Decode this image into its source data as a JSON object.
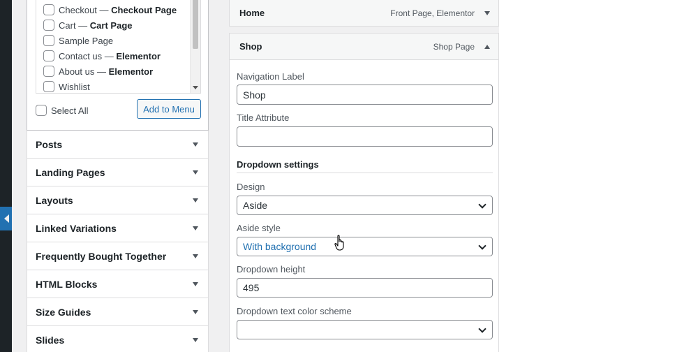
{
  "left_panel": {
    "pages": [
      {
        "label": "Checkout",
        "tag": "Checkout Page"
      },
      {
        "label": "Cart",
        "tag": "Cart Page"
      },
      {
        "label": "Sample Page",
        "tag": ""
      },
      {
        "label": "Contact us",
        "tag": "Elementor"
      },
      {
        "label": "About us",
        "tag": "Elementor"
      },
      {
        "label": "Wishlist",
        "tag": ""
      }
    ],
    "separator": " — ",
    "select_all_label": "Select All",
    "add_to_menu_label": "Add to Menu",
    "accordions": [
      "Posts",
      "Landing Pages",
      "Layouts",
      "Linked Variations",
      "Frequently Bought Together",
      "HTML Blocks",
      "Size Guides",
      "Slides"
    ]
  },
  "menu_items": [
    {
      "title": "Home",
      "meta": "Front Page, Elementor",
      "expanded": false
    },
    {
      "title": "Shop",
      "meta": "Shop Page",
      "expanded": true
    }
  ],
  "item_settings": {
    "nav_label_label": "Navigation Label",
    "nav_label_value": "Shop",
    "title_attr_label": "Title Attribute",
    "title_attr_value": "",
    "dropdown_section": "Dropdown settings",
    "design_label": "Design",
    "design_value": "Aside",
    "aside_style_label": "Aside style",
    "aside_style_value": "With background",
    "dropdown_height_label": "Dropdown height",
    "dropdown_height_value": "495",
    "text_color_label": "Dropdown text color scheme",
    "text_color_value": ""
  },
  "colors": {
    "accent": "#2271b1",
    "admin_sidebar": "#1d2327",
    "background": "#f0f0f1"
  }
}
